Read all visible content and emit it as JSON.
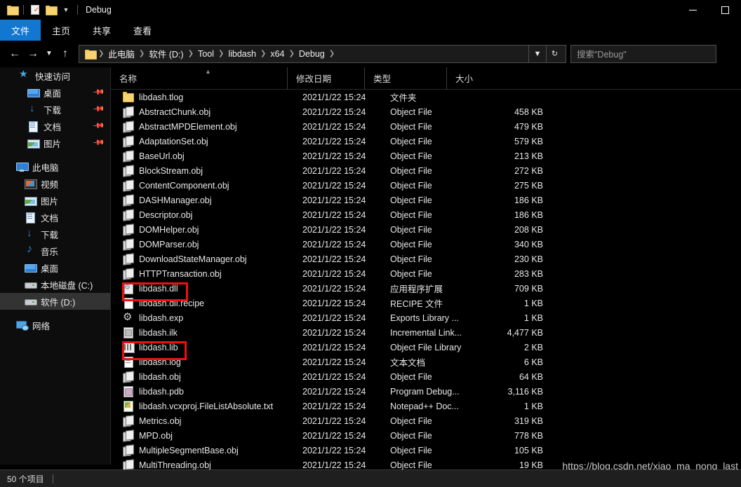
{
  "window": {
    "title": "Debug",
    "quick_access_icons": [
      "folder-icon",
      "save-checked-icon",
      "folder-icon",
      "dropdown-caret-icon"
    ],
    "controls": {
      "minimize": "minimize-icon",
      "maximize": "maximize-icon"
    }
  },
  "ribbon": {
    "tabs": [
      {
        "label": "文件",
        "active": true
      },
      {
        "label": "主页",
        "active": false
      },
      {
        "label": "共享",
        "active": false
      },
      {
        "label": "查看",
        "active": false
      }
    ]
  },
  "address_bar": {
    "back": "back-arrow-icon",
    "forward": "forward-arrow-icon",
    "recent": "recent-locations-caret-icon",
    "up": "up-arrow-icon",
    "breadcrumbs": [
      "此电脑",
      "软件 (D:)",
      "Tool",
      "libdash",
      "x64",
      "Debug"
    ],
    "history_caret": "history-caret-icon",
    "refresh": "refresh-icon",
    "search_placeholder": "搜索\"Debug\""
  },
  "sidebar": {
    "groups": [
      {
        "header": {
          "label": "快速访问",
          "icon": "star-pin-icon"
        },
        "items": [
          {
            "label": "桌面",
            "icon": "desktop-icon",
            "pinned": true
          },
          {
            "label": "下载",
            "icon": "downloads-icon",
            "pinned": true
          },
          {
            "label": "文档",
            "icon": "documents-icon",
            "pinned": true
          },
          {
            "label": "图片",
            "icon": "pictures-icon",
            "pinned": true
          }
        ]
      },
      {
        "header": {
          "label": "此电脑",
          "icon": "this-pc-icon"
        },
        "items": [
          {
            "label": "视频",
            "icon": "videos-icon",
            "pinned": false
          },
          {
            "label": "图片",
            "icon": "pictures-icon",
            "pinned": false
          },
          {
            "label": "文档",
            "icon": "documents-icon",
            "pinned": false
          },
          {
            "label": "下载",
            "icon": "downloads-icon",
            "pinned": false
          },
          {
            "label": "音乐",
            "icon": "music-icon",
            "pinned": false
          },
          {
            "label": "桌面",
            "icon": "desktop-icon",
            "pinned": false
          },
          {
            "label": "本地磁盘 (C:)",
            "icon": "drive-icon",
            "pinned": false
          },
          {
            "label": "软件 (D:)",
            "icon": "drive-icon",
            "pinned": false,
            "selected": true
          }
        ]
      },
      {
        "header": {
          "label": "网络",
          "icon": "network-icon"
        },
        "items": []
      }
    ]
  },
  "file_list": {
    "columns": [
      {
        "key": "name",
        "label": "名称",
        "sorted": "asc"
      },
      {
        "key": "date",
        "label": "修改日期"
      },
      {
        "key": "type",
        "label": "类型"
      },
      {
        "key": "size",
        "label": "大小"
      }
    ],
    "rows": [
      {
        "name": "libdash.tlog",
        "date": "2021/1/22 15:24",
        "type": "文件夹",
        "size": "",
        "icon": "folder-icon"
      },
      {
        "name": "AbstractChunk.obj",
        "date": "2021/1/22 15:24",
        "type": "Object File",
        "size": "458 KB",
        "icon": "object-file-icon"
      },
      {
        "name": "AbstractMPDElement.obj",
        "date": "2021/1/22 15:24",
        "type": "Object File",
        "size": "479 KB",
        "icon": "object-file-icon"
      },
      {
        "name": "AdaptationSet.obj",
        "date": "2021/1/22 15:24",
        "type": "Object File",
        "size": "579 KB",
        "icon": "object-file-icon"
      },
      {
        "name": "BaseUrl.obj",
        "date": "2021/1/22 15:24",
        "type": "Object File",
        "size": "213 KB",
        "icon": "object-file-icon"
      },
      {
        "name": "BlockStream.obj",
        "date": "2021/1/22 15:24",
        "type": "Object File",
        "size": "272 KB",
        "icon": "object-file-icon"
      },
      {
        "name": "ContentComponent.obj",
        "date": "2021/1/22 15:24",
        "type": "Object File",
        "size": "275 KB",
        "icon": "object-file-icon"
      },
      {
        "name": "DASHManager.obj",
        "date": "2021/1/22 15:24",
        "type": "Object File",
        "size": "186 KB",
        "icon": "object-file-icon"
      },
      {
        "name": "Descriptor.obj",
        "date": "2021/1/22 15:24",
        "type": "Object File",
        "size": "186 KB",
        "icon": "object-file-icon"
      },
      {
        "name": "DOMHelper.obj",
        "date": "2021/1/22 15:24",
        "type": "Object File",
        "size": "208 KB",
        "icon": "object-file-icon"
      },
      {
        "name": "DOMParser.obj",
        "date": "2021/1/22 15:24",
        "type": "Object File",
        "size": "340 KB",
        "icon": "object-file-icon"
      },
      {
        "name": "DownloadStateManager.obj",
        "date": "2021/1/22 15:24",
        "type": "Object File",
        "size": "230 KB",
        "icon": "object-file-icon"
      },
      {
        "name": "HTTPTransaction.obj",
        "date": "2021/1/22 15:24",
        "type": "Object File",
        "size": "283 KB",
        "icon": "object-file-icon"
      },
      {
        "name": "libdash.dll",
        "date": "2021/1/22 15:24",
        "type": "应用程序扩展",
        "size": "709 KB",
        "icon": "dll-icon",
        "highlighted": true
      },
      {
        "name": "libdash.dll.recipe",
        "date": "2021/1/22 15:24",
        "type": "RECIPE 文件",
        "size": "1 KB",
        "icon": "blank-page-icon"
      },
      {
        "name": "libdash.exp",
        "date": "2021/1/22 15:24",
        "type": "Exports Library ...",
        "size": "1 KB",
        "icon": "gear-file-icon"
      },
      {
        "name": "libdash.ilk",
        "date": "2021/1/22 15:24",
        "type": "Incremental Link...",
        "size": "4,477 KB",
        "icon": "ilk-file-icon"
      },
      {
        "name": "libdash.lib",
        "date": "2021/1/22 15:24",
        "type": "Object File Library",
        "size": "2 KB",
        "icon": "library-icon",
        "highlighted": true
      },
      {
        "name": "libdash.log",
        "date": "2021/1/22 15:24",
        "type": "文本文档",
        "size": "6 KB",
        "icon": "text-file-icon"
      },
      {
        "name": "libdash.obj",
        "date": "2021/1/22 15:24",
        "type": "Object File",
        "size": "64 KB",
        "icon": "object-file-icon"
      },
      {
        "name": "libdash.pdb",
        "date": "2021/1/22 15:24",
        "type": "Program Debug...",
        "size": "3,116 KB",
        "icon": "pdb-file-icon"
      },
      {
        "name": "libdash.vcxproj.FileListAbsolute.txt",
        "date": "2021/1/22 15:24",
        "type": "Notepad++ Doc...",
        "size": "1 KB",
        "icon": "notepadpp-icon"
      },
      {
        "name": "Metrics.obj",
        "date": "2021/1/22 15:24",
        "type": "Object File",
        "size": "319 KB",
        "icon": "object-file-icon"
      },
      {
        "name": "MPD.obj",
        "date": "2021/1/22 15:24",
        "type": "Object File",
        "size": "778 KB",
        "icon": "object-file-icon"
      },
      {
        "name": "MultipleSegmentBase.obj",
        "date": "2021/1/22 15:24",
        "type": "Object File",
        "size": "105 KB",
        "icon": "object-file-icon"
      },
      {
        "name": "MultiThreading.obj",
        "date": "2021/1/22 15:24",
        "type": "Object File",
        "size": "19 KB",
        "icon": "object-file-icon"
      }
    ]
  },
  "status_bar": {
    "item_count": "50 个项目"
  },
  "watermark": {
    "text": "https://blog.csdn.net/xiao_ma_nong_last"
  },
  "colors": {
    "accent": "#1177d1",
    "background": "#000000",
    "sidebar_bg": "#0d0d0d",
    "selected_row": "#333333",
    "annotation_red": "#ee1111",
    "status_bg": "#1f1f1f"
  }
}
